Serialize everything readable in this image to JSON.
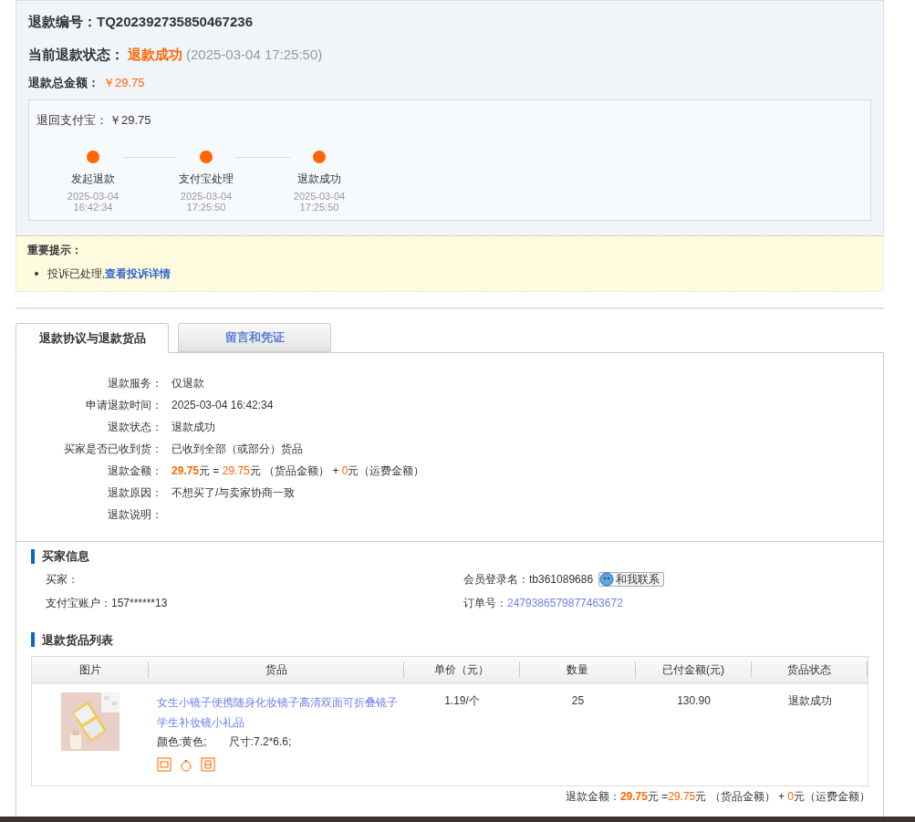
{
  "summary": {
    "refund_no_label": "退款编号：",
    "refund_no": "TQ202392735850467236",
    "status_label": "当前退款状态：",
    "status": "退款成功",
    "status_time": "(2025-03-04 17:25:50)",
    "total_label": "退款总金额：",
    "total": "￥29.75"
  },
  "alipay": {
    "label": "退回支付宝：",
    "amount": "￥29.75",
    "steps": [
      {
        "label": "发起退款",
        "date": "2025-03-04",
        "time": "16:42:34",
        "done": true
      },
      {
        "label": "支付宝处理",
        "date": "2025-03-04",
        "time": "17:25:50",
        "done": true
      },
      {
        "label": "退款成功",
        "date": "2025-03-04",
        "time": "17:25:50",
        "done": true
      }
    ]
  },
  "notice": {
    "title": "重要提示：",
    "items": [
      {
        "text": "投诉已处理,",
        "link": "查看投诉详情"
      }
    ]
  },
  "tabs": [
    {
      "label": "退款协议与退款货品",
      "selected": true
    },
    {
      "label": "留言和凭证",
      "selected": false
    }
  ],
  "details": [
    {
      "label": "退款服务：",
      "value": "仅退款"
    },
    {
      "label": "申请退款时间：",
      "value": "2025-03-04 16:42:34"
    },
    {
      "label": "退款状态：",
      "value": "退款成功"
    },
    {
      "label": "买家是否已收到货：",
      "value": "已收到全部（或部分）货品"
    },
    {
      "label": "退款金额：",
      "segments": [
        {
          "kind": "total",
          "text": "29.75"
        },
        {
          "kind": "text",
          "text": "元 = "
        },
        {
          "kind": "amount",
          "text": "29.75"
        },
        {
          "kind": "text",
          "text": "元 （货品金额） + "
        },
        {
          "kind": "amount",
          "text": "0"
        },
        {
          "kind": "text",
          "text": "元（运费金额）"
        }
      ]
    },
    {
      "label": "退款原因：",
      "value": "不想买了/与卖家协商一致"
    },
    {
      "label": "退款说明："
    }
  ],
  "buyer": {
    "title": "买家信息",
    "buyer_label": "买家：",
    "account_label": "支付宝账户：",
    "account": "157******13",
    "member_label": "会员登录名：",
    "member": "tb361089686",
    "contact": "和我联系",
    "order_label": "订单号：",
    "order": "2479386579877463672"
  },
  "goods": {
    "title": "退款货品列表",
    "columns": [
      "图片",
      "货品",
      "单价（元）",
      "数量",
      "已付金额(元)",
      "货品状态"
    ],
    "rows": [
      {
        "name": "女生小镜子便携随身化妆镜子高清双面可折叠镜子学生补妆镜小礼品",
        "variant": "颜色:黄色;",
        "size": "尺寸:7.2*6.6;",
        "price": "1.19/个",
        "qty": "25",
        "paid": "130.90",
        "status": "退款成功"
      }
    ],
    "footer": [
      {
        "kind": "text",
        "text": "退款金额："
      },
      {
        "kind": "total",
        "text": "29.75"
      },
      {
        "kind": "text",
        "text": "元 ="
      },
      {
        "kind": "amount",
        "text": "29.75"
      },
      {
        "kind": "text",
        "text": "元 （货品金额） + "
      },
      {
        "kind": "amount",
        "text": "0"
      },
      {
        "kind": "text",
        "text": "元（运费金额）"
      }
    ]
  }
}
